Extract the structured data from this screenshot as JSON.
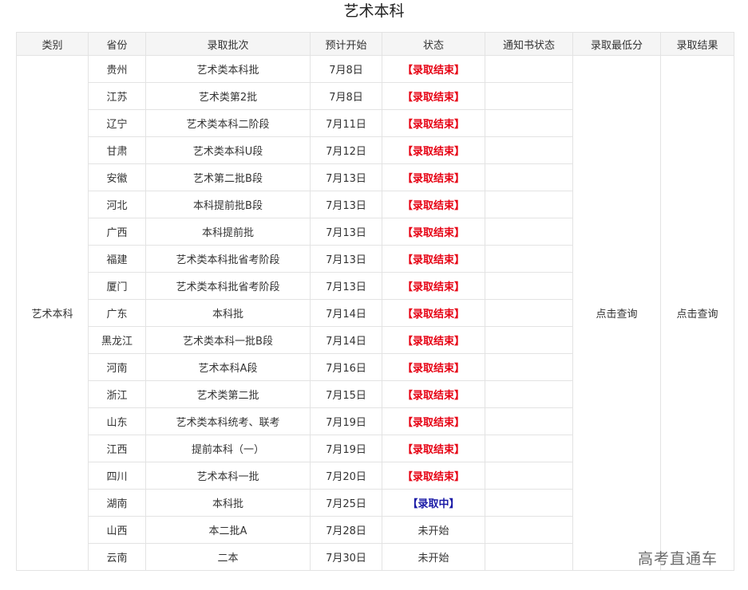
{
  "title": "艺术本科",
  "headers": [
    "类别",
    "省份",
    "录取批次",
    "预计开始",
    "状态",
    "通知书状态",
    "录取最低分",
    "录取结果"
  ],
  "category": "艺术本科",
  "min_score_link": "点击查询",
  "result_link": "点击查询",
  "watermark": "高考直通车",
  "colors": {
    "status_ended": "#e60012",
    "status_in_progress": "#1a1aa6",
    "header_bg": "#f5f5f5",
    "border": "#e3e3e3"
  },
  "rows": [
    {
      "province": "贵州",
      "batch": "艺术类本科批",
      "start": "7月8日",
      "status": "【录取结束】",
      "status_type": "ended",
      "notice": ""
    },
    {
      "province": "江苏",
      "batch": "艺术类第2批",
      "start": "7月8日",
      "status": "【录取结束】",
      "status_type": "ended",
      "notice": ""
    },
    {
      "province": "辽宁",
      "batch": "艺术类本科二阶段",
      "start": "7月11日",
      "status": "【录取结束】",
      "status_type": "ended",
      "notice": ""
    },
    {
      "province": "甘肃",
      "batch": "艺术类本科U段",
      "start": "7月12日",
      "status": "【录取结束】",
      "status_type": "ended",
      "notice": ""
    },
    {
      "province": "安徽",
      "batch": "艺术第二批B段",
      "start": "7月13日",
      "status": "【录取结束】",
      "status_type": "ended",
      "notice": ""
    },
    {
      "province": "河北",
      "batch": "本科提前批B段",
      "start": "7月13日",
      "status": "【录取结束】",
      "status_type": "ended",
      "notice": ""
    },
    {
      "province": "广西",
      "batch": "本科提前批",
      "start": "7月13日",
      "status": "【录取结束】",
      "status_type": "ended",
      "notice": ""
    },
    {
      "province": "福建",
      "batch": "艺术类本科批省考阶段",
      "start": "7月13日",
      "status": "【录取结束】",
      "status_type": "ended",
      "notice": ""
    },
    {
      "province": "厦门",
      "batch": "艺术类本科批省考阶段",
      "start": "7月13日",
      "status": "【录取结束】",
      "status_type": "ended",
      "notice": ""
    },
    {
      "province": "广东",
      "batch": "本科批",
      "start": "7月14日",
      "status": "【录取结束】",
      "status_type": "ended",
      "notice": ""
    },
    {
      "province": "黑龙江",
      "batch": "艺术类本科一批B段",
      "start": "7月14日",
      "status": "【录取结束】",
      "status_type": "ended",
      "notice": ""
    },
    {
      "province": "河南",
      "batch": "艺术本科A段",
      "start": "7月16日",
      "status": "【录取结束】",
      "status_type": "ended",
      "notice": ""
    },
    {
      "province": "浙江",
      "batch": "艺术类第二批",
      "start": "7月15日",
      "status": "【录取结束】",
      "status_type": "ended",
      "notice": ""
    },
    {
      "province": "山东",
      "batch": "艺术类本科统考、联考",
      "start": "7月19日",
      "status": "【录取结束】",
      "status_type": "ended",
      "notice": ""
    },
    {
      "province": "江西",
      "batch": "提前本科（一）",
      "start": "7月19日",
      "status": "【录取结束】",
      "status_type": "ended",
      "notice": ""
    },
    {
      "province": "四川",
      "batch": "艺术本科一批",
      "start": "7月20日",
      "status": "【录取结束】",
      "status_type": "ended",
      "notice": ""
    },
    {
      "province": "湖南",
      "batch": "本科批",
      "start": "7月25日",
      "status": "【录取中】",
      "status_type": "in-progress",
      "notice": ""
    },
    {
      "province": "山西",
      "batch": "本二批A",
      "start": "7月28日",
      "status": "未开始",
      "status_type": "not-started",
      "notice": ""
    },
    {
      "province": "云南",
      "batch": "二本",
      "start": "7月30日",
      "status": "未开始",
      "status_type": "not-started",
      "notice": ""
    }
  ]
}
